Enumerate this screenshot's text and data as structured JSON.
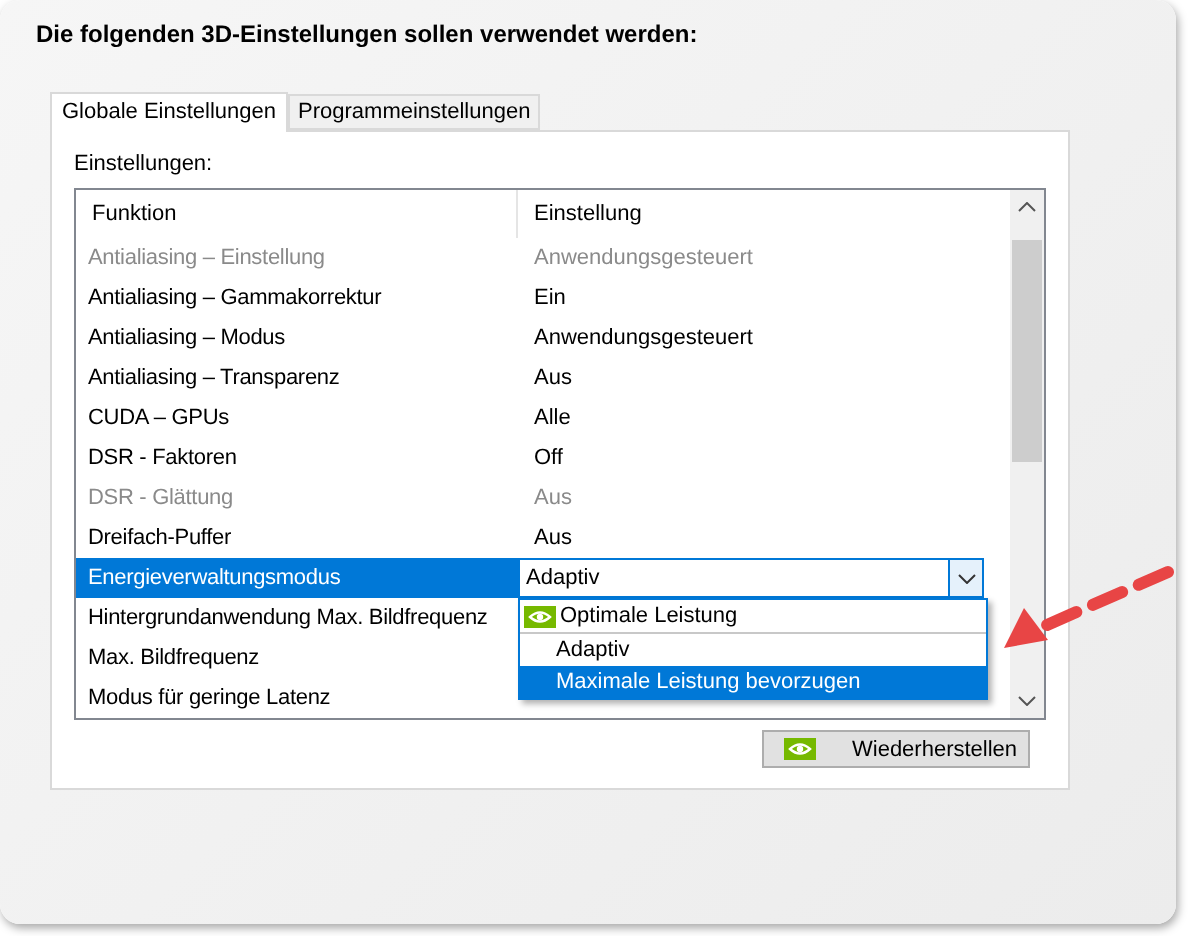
{
  "title": "Die folgenden 3D-Einstellungen sollen verwendet werden:",
  "tabs": [
    {
      "label": "Globale Einstellungen",
      "selected": true
    },
    {
      "label": "Programmeinstellungen",
      "selected": false
    }
  ],
  "settings_label": "Einstellungen:",
  "table": {
    "columns": [
      "Funktion",
      "Einstellung"
    ],
    "rows": [
      {
        "function": "Antialiasing – Einstellung",
        "value": "Anwendungsgesteuert",
        "disabled": true,
        "selected": false
      },
      {
        "function": "Antialiasing – Gammakorrektur",
        "value": "Ein",
        "disabled": false,
        "selected": false
      },
      {
        "function": "Antialiasing – Modus",
        "value": "Anwendungsgesteuert",
        "disabled": false,
        "selected": false
      },
      {
        "function": "Antialiasing – Transparenz",
        "value": "Aus",
        "disabled": false,
        "selected": false
      },
      {
        "function": "CUDA – GPUs",
        "value": "Alle",
        "disabled": false,
        "selected": false
      },
      {
        "function": "DSR - Faktoren",
        "value": "Off",
        "disabled": false,
        "selected": false
      },
      {
        "function": "DSR - Glättung",
        "value": "Aus",
        "disabled": true,
        "selected": false
      },
      {
        "function": "Dreifach-Puffer",
        "value": "Aus",
        "disabled": false,
        "selected": false
      },
      {
        "function": "Energieverwaltungsmodus",
        "value": "Adaptiv",
        "disabled": false,
        "selected": true
      },
      {
        "function": "Hintergrundanwendung Max. Bildfrequenz",
        "disabled": false,
        "selected": false
      },
      {
        "function": "Max. Bildfrequenz",
        "disabled": false,
        "selected": false
      },
      {
        "function": "Modus für geringe Latenz",
        "disabled": false,
        "selected": false
      }
    ]
  },
  "dropdown": {
    "options": [
      {
        "label": "Optimale Leistung",
        "recommended": true,
        "selected": false
      },
      {
        "label": "Adaptiv",
        "recommended": false,
        "selected": false
      },
      {
        "label": "Maximale Leistung bevorzugen",
        "recommended": false,
        "selected": true
      }
    ]
  },
  "restore_button": "Wiederherstellen"
}
